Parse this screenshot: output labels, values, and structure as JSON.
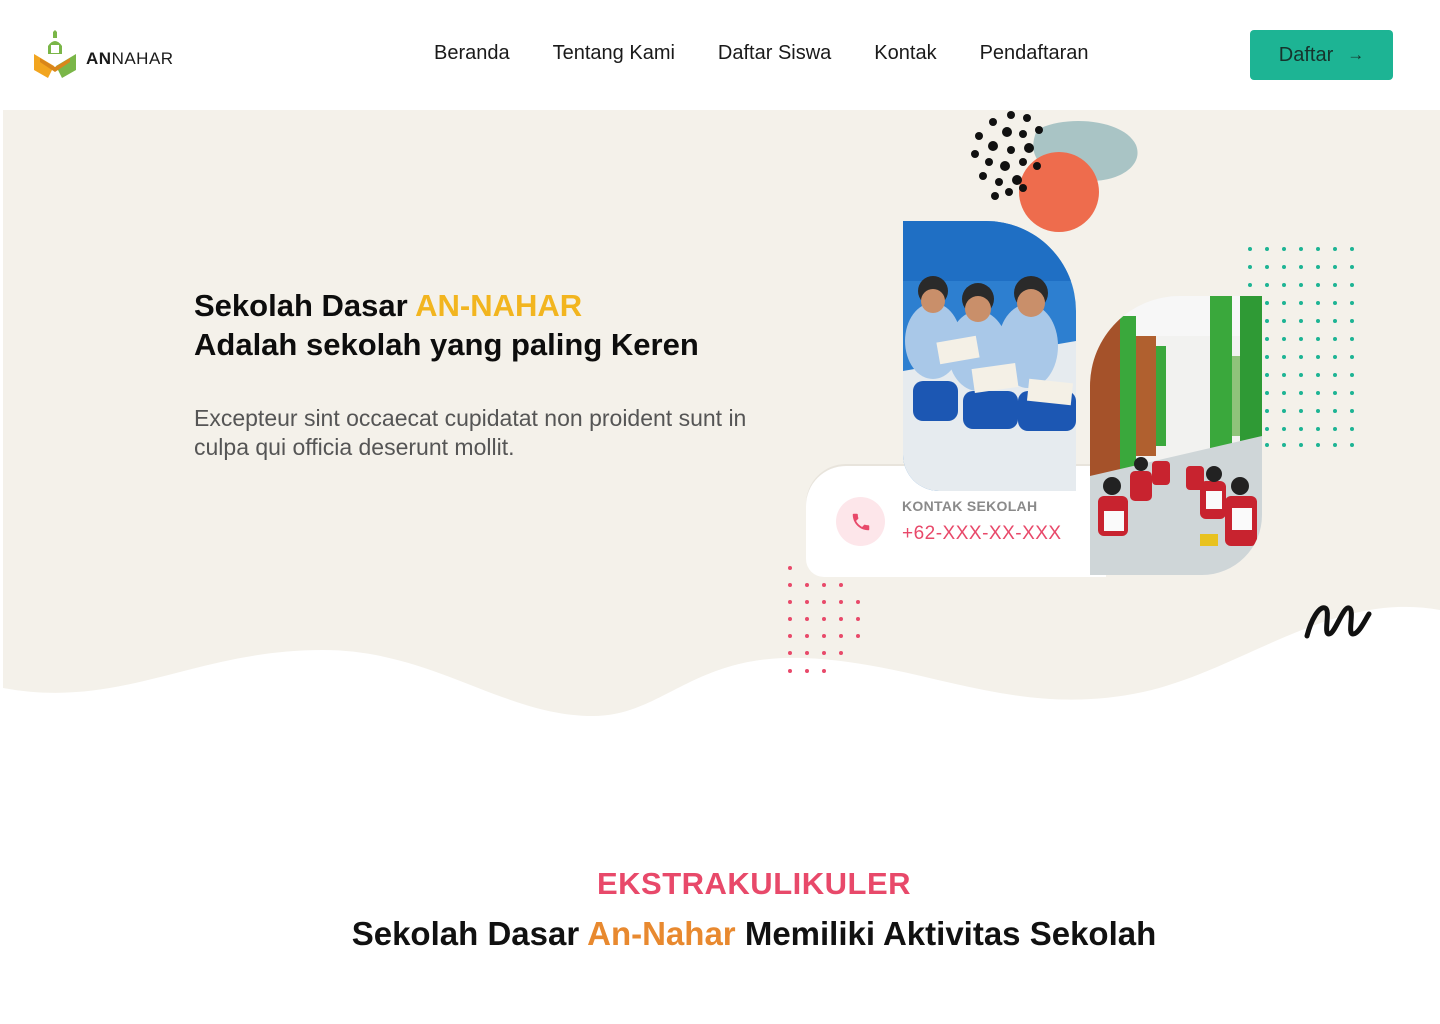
{
  "brand": {
    "name_bold": "AN",
    "name_rest": "NAHAR"
  },
  "nav": {
    "items": [
      {
        "label": "Beranda"
      },
      {
        "label": "Tentang Kami"
      },
      {
        "label": "Daftar Siswa"
      },
      {
        "label": "Kontak"
      },
      {
        "label": "Pendaftaran"
      }
    ],
    "cta_label": "Daftar",
    "cta_icon": "arrow-right-icon"
  },
  "hero": {
    "title_line1_prefix": "Sekolah Dasar ",
    "title_line1_accent": "AN-NAHAR",
    "title_line2": "Adalah sekolah yang paling Keren",
    "description": "Excepteur sint occaecat cupidatat non proident sunt in culpa qui officia deserunt mollit.",
    "contact_label": "KONTAK SEKOLAH",
    "contact_number": "+62-XXX-XX-XXX",
    "contact_icon": "phone-icon"
  },
  "section": {
    "kicker": "EKSTRAKULIKULER",
    "title_prefix": "Sekolah Dasar ",
    "title_accent": "An-Nahar",
    "title_suffix": " Memiliki Aktivitas Sekolah"
  },
  "colors": {
    "primary": "#1db494",
    "accent_yellow": "#f2b51f",
    "accent_pink": "#e8496a",
    "accent_orange": "#e8892f",
    "hero_bg": "#f4f1ea"
  }
}
